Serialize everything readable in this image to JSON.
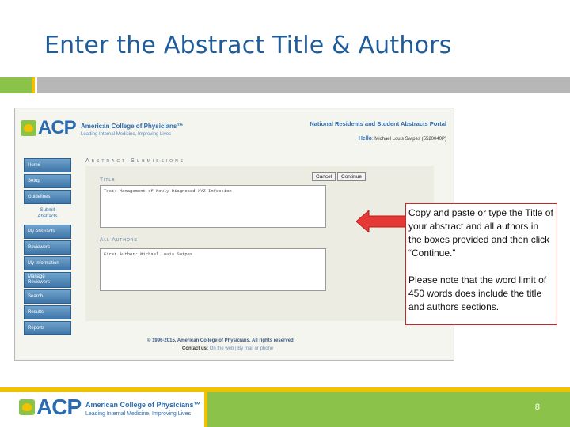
{
  "slide": {
    "title": "Enter the Abstract Title & Authors",
    "page_number": "8"
  },
  "colors": {
    "title_blue": "#1f5c99",
    "acp_blue": "#2a6cb2",
    "green": "#8bc34a",
    "yellow": "#f2c200",
    "gray_bar": "#b7b7b7",
    "callout_border": "#c62828",
    "arrow_red": "#e53935"
  },
  "logo": {
    "acp": "ACP",
    "name": "American College of Physicians™",
    "tagline_small": "Leading Internal Medicine, Improving Lives",
    "tagline_footer": "Leading Internal Medicine, Improving Lives"
  },
  "portal": {
    "title": "National Residents and Student Abstracts Portal",
    "hello_label": "Hello",
    "hello_user": "Michael Louis Swipes (5520040P)"
  },
  "sidebar": {
    "items": [
      {
        "label": "Home"
      },
      {
        "label": "Setup"
      },
      {
        "label": "Guidelines"
      },
      {
        "label_line1": "Submit",
        "label_line2": "Abstracts"
      },
      {
        "label": "My Abstracts"
      },
      {
        "label": "Reviewers"
      },
      {
        "label": "My Information"
      },
      {
        "label_line1": "Manage",
        "label_line2": "Reviewers"
      },
      {
        "label": "Search"
      },
      {
        "label": "Results"
      },
      {
        "label": "Reports"
      }
    ]
  },
  "form": {
    "section_heading": "Abstract Submissions",
    "cancel_label": "Cancel",
    "continue_label": "Continue",
    "title_label": "Title",
    "title_value": "Test: Management of Newly Diagnosed XYZ Infection",
    "authors_label": "All Authors",
    "authors_value": "First Author: Michael Louis Swipes"
  },
  "footer": {
    "copyright": "© 1996-2015, American College of Physicians. All rights reserved.",
    "contact_label": "Contact us:",
    "contact_links": "On the web | By mail or phone"
  },
  "callout": {
    "paragraph1": "Copy and paste or type the Title of your abstract and all authors in the boxes provided and then click “Continue.”",
    "paragraph2": "Please note that the word limit of 450 words does include the title and authors sections."
  }
}
